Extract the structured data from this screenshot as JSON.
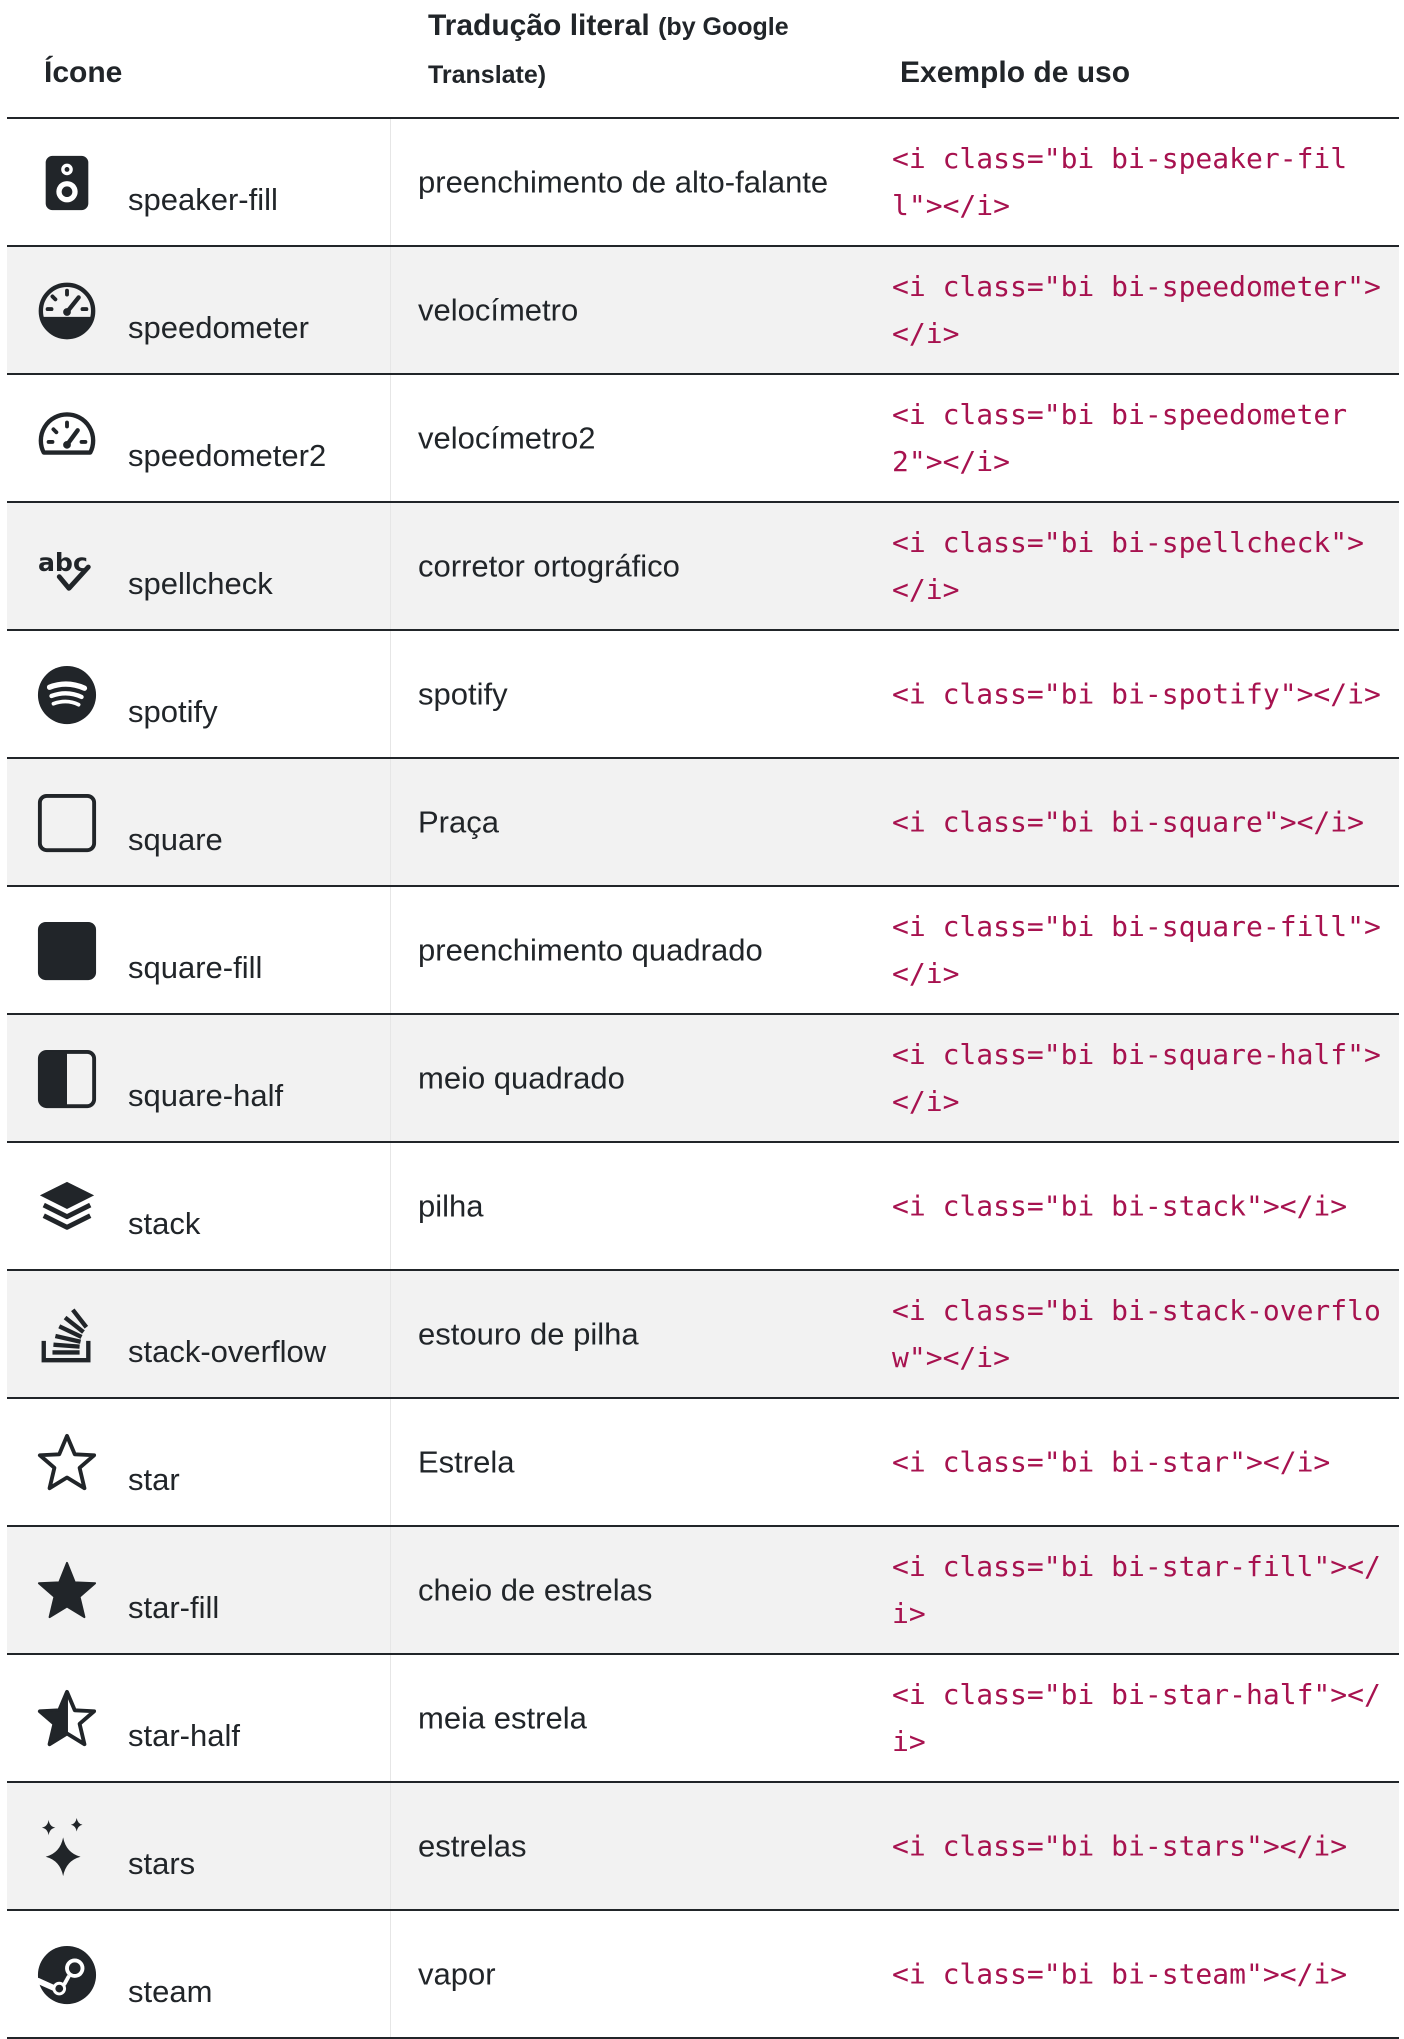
{
  "headers": {
    "icon": "Ícone",
    "translation_main": "Tradução literal",
    "translation_note_1": "(by Google",
    "translation_note_2": "Translate)",
    "example": "Exemplo de uso"
  },
  "rows": [
    {
      "name": "speaker-fill",
      "icon": "speaker-fill-icon",
      "translation": "preenchimento de alto-falante",
      "example": "<i class=\"bi bi-speaker-fill\"></i>"
    },
    {
      "name": "speedometer",
      "icon": "speedometer-icon",
      "translation": "velocímetro",
      "example": "<i class=\"bi bi-speedometer\"></i>"
    },
    {
      "name": "speedometer2",
      "icon": "speedometer2-icon",
      "translation": "velocímetro2",
      "example": "<i class=\"bi bi-speedometer2\"></i>"
    },
    {
      "name": "spellcheck",
      "icon": "spellcheck-icon",
      "translation": "corretor ortográfico",
      "example": "<i class=\"bi bi-spellcheck\"></i>"
    },
    {
      "name": "spotify",
      "icon": "spotify-icon",
      "translation": "spotify",
      "example": "<i class=\"bi bi-spotify\"></i>"
    },
    {
      "name": "square",
      "icon": "square-icon",
      "translation": "Praça",
      "example": "<i class=\"bi bi-square\"></i>"
    },
    {
      "name": "square-fill",
      "icon": "square-fill-icon",
      "translation": "preenchimento quadrado",
      "example": "<i class=\"bi bi-square-fill\"></i>"
    },
    {
      "name": "square-half",
      "icon": "square-half-icon",
      "translation": "meio quadrado",
      "example": "<i class=\"bi bi-square-half\"></i>"
    },
    {
      "name": "stack",
      "icon": "stack-icon",
      "translation": "pilha",
      "example": "<i class=\"bi bi-stack\"></i>"
    },
    {
      "name": "stack-overflow",
      "icon": "stack-overflow-icon",
      "translation": "estouro de pilha",
      "example": "<i class=\"bi bi-stack-overflow\"></i>"
    },
    {
      "name": "star",
      "icon": "star-icon",
      "translation": "Estrela",
      "example": "<i class=\"bi bi-star\"></i>"
    },
    {
      "name": "star-fill",
      "icon": "star-fill-icon",
      "translation": "cheio de estrelas",
      "example": "<i class=\"bi bi-star-fill\"></i>"
    },
    {
      "name": "star-half",
      "icon": "star-half-icon",
      "translation": "meia estrela",
      "example": "<i class=\"bi bi-star-half\"></i>"
    },
    {
      "name": "stars",
      "icon": "stars-icon",
      "translation": "estrelas",
      "example": "<i class=\"bi bi-stars\"></i>"
    },
    {
      "name": "steam",
      "icon": "steam-icon",
      "translation": "vapor",
      "example": "<i class=\"bi bi-steam\"></i>"
    }
  ]
}
